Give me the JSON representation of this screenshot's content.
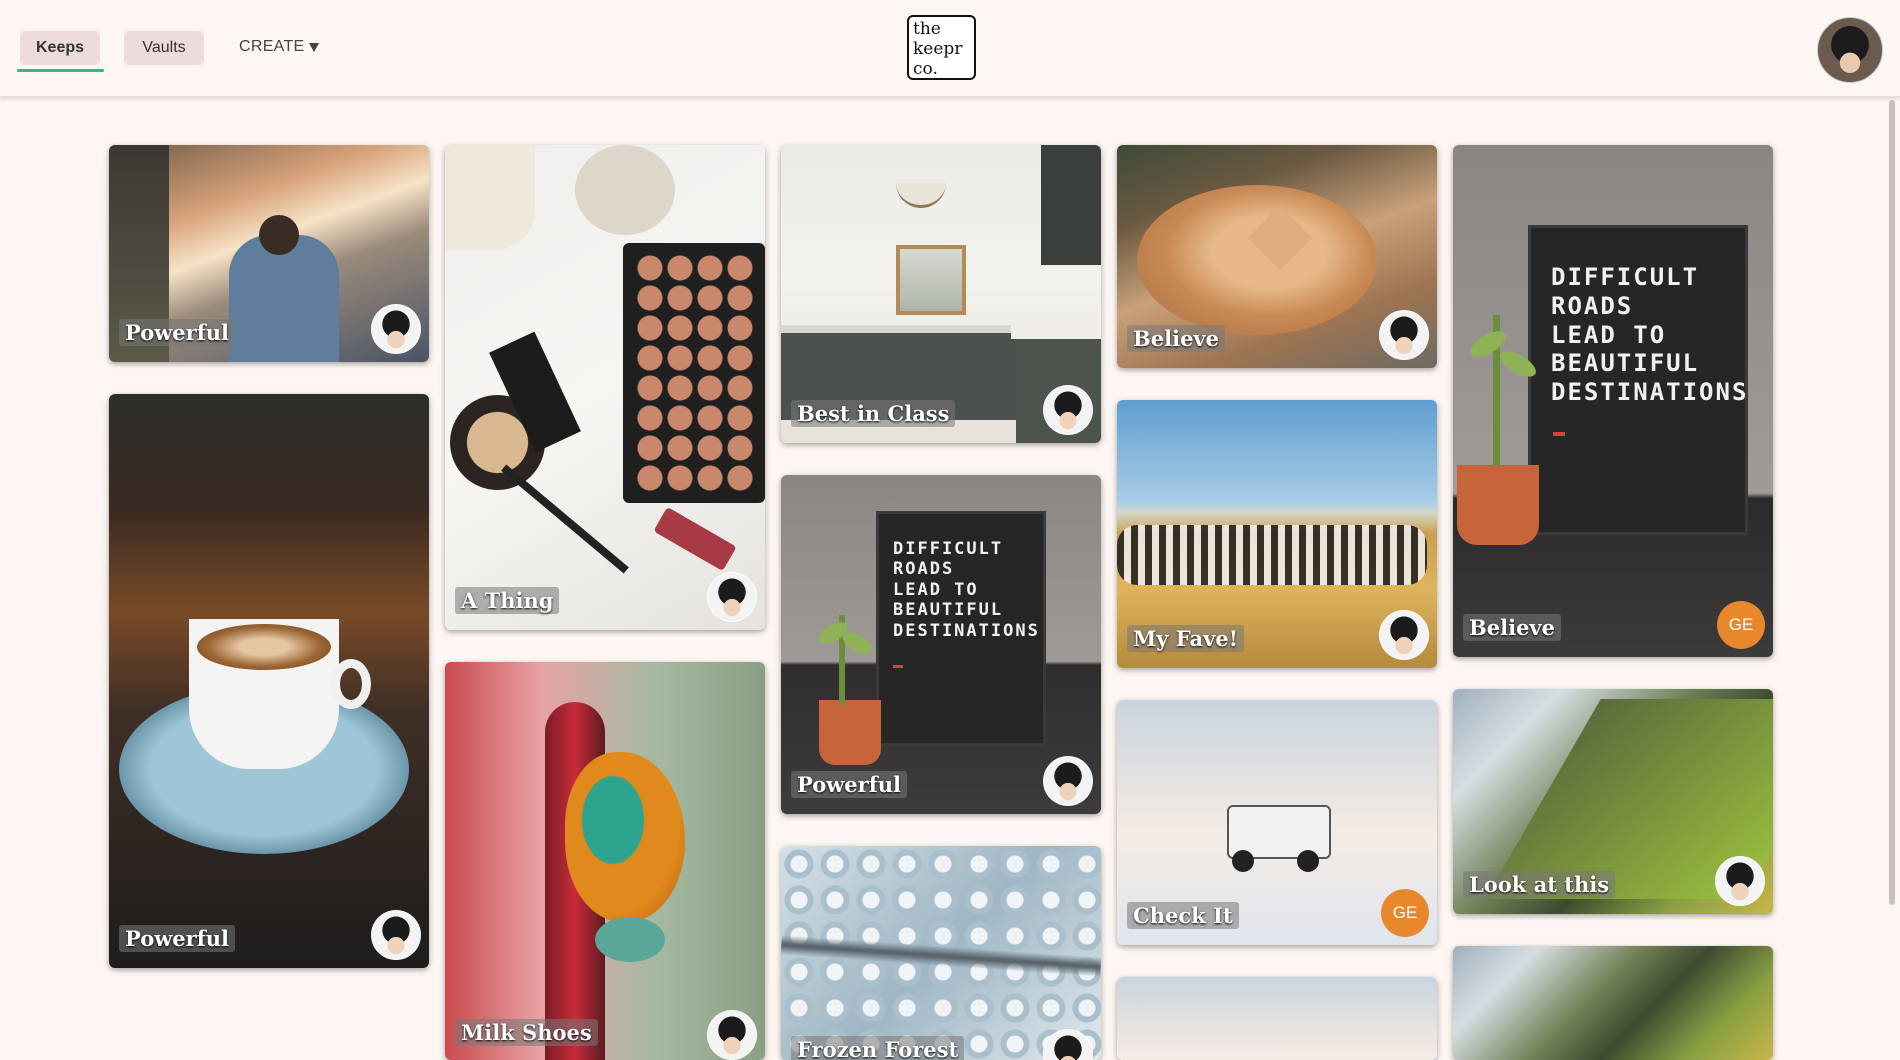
{
  "nav": {
    "tabs": [
      {
        "label": "Keeps",
        "active": true
      },
      {
        "label": "Vaults",
        "active": false
      }
    ],
    "create_label": "CREATE",
    "logo_lines": [
      "the",
      "keepr",
      "co."
    ],
    "accent_color": "#2dbd7a"
  },
  "keeps": [
    {
      "title": "Powerful",
      "owner": "avatar"
    },
    {
      "title": "Powerful",
      "owner": "avatar"
    },
    {
      "title": "A Thing",
      "owner": "avatar"
    },
    {
      "title": "Milk Shoes",
      "owner": "avatar"
    },
    {
      "title": "Best in Class",
      "owner": "avatar"
    },
    {
      "title": "Powerful",
      "owner": "avatar",
      "board_text": "DIFFICULT\nROADS\nLEAD TO\nBEAUTIFUL\nDESTINATIONS"
    },
    {
      "title": "Frozen Forest",
      "owner": "avatar"
    },
    {
      "title": "Believe",
      "owner": "avatar"
    },
    {
      "title": "My Fave!",
      "owner": "avatar"
    },
    {
      "title": "Check It",
      "owner": "initials",
      "initials": "GE"
    },
    {
      "title": "",
      "owner": "none"
    },
    {
      "title": "Believe",
      "owner": "initials",
      "initials": "GE",
      "board_text": "DIFFICULT\nROADS\nLEAD TO\nBEAUTIFUL\nDESTINATIONS"
    },
    {
      "title": "Look at this",
      "owner": "avatar"
    },
    {
      "title": "",
      "owner": "none"
    }
  ]
}
